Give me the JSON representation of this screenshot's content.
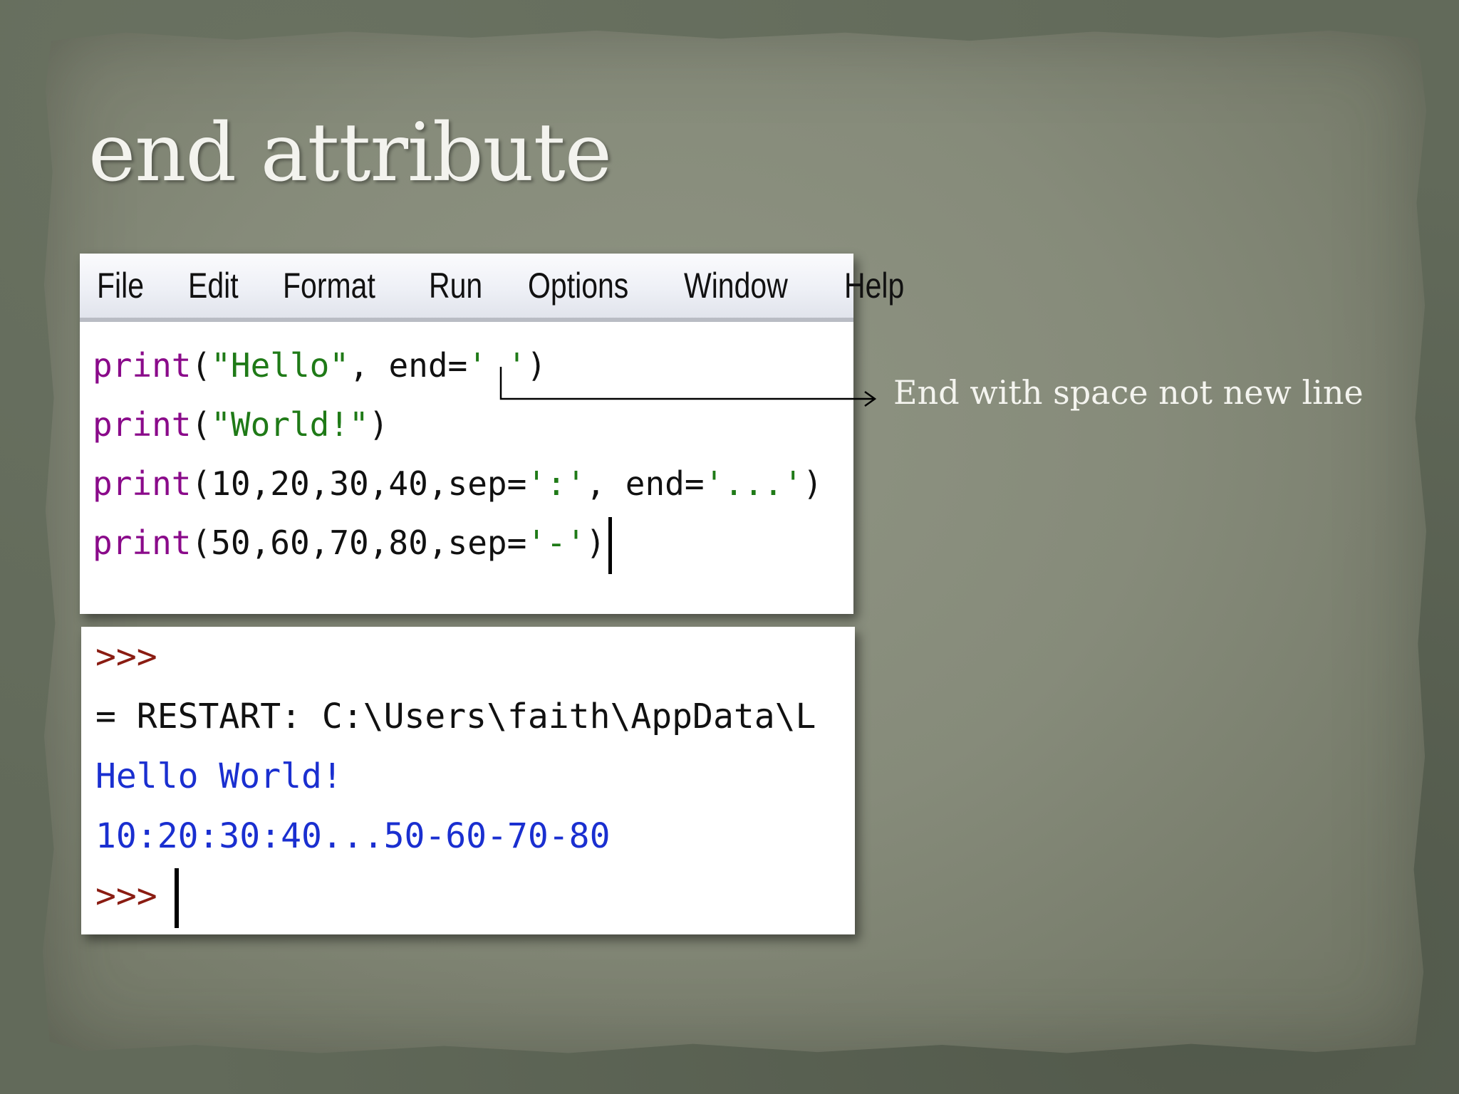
{
  "slide": {
    "title": "end attribute",
    "annotation": "End with space not new line"
  },
  "editor": {
    "menu": [
      "File",
      "Edit",
      "Format",
      "Run",
      "Options",
      "Window",
      "Help"
    ],
    "code": [
      {
        "fn": "print",
        "open": "(",
        "str1": "\"Hello\"",
        "mid": ", end=",
        "str2": "' '",
        "close": ")"
      },
      {
        "fn": "print",
        "open": "(",
        "str1": "\"World!\"",
        "mid": "",
        "str2": "",
        "close": ")"
      },
      {
        "fn": "print",
        "open": "(",
        "str1": "",
        "mid": "10,20,30,40,sep=",
        "str2": "':'",
        "mid2": ", end=",
        "str3": "'...'",
        "close": ")"
      },
      {
        "fn": "print",
        "open": "(",
        "str1": "",
        "mid": "50,60,70,80,sep=",
        "str2": "'-'",
        "close": ")"
      }
    ]
  },
  "shell": {
    "prompt": ">>>",
    "restart": "= RESTART: C:\\Users\\faith\\AppData\\L",
    "output1": "Hello World!",
    "output2": "10:20:30:40...50-60-70-80",
    "prompt2": ">>>"
  }
}
